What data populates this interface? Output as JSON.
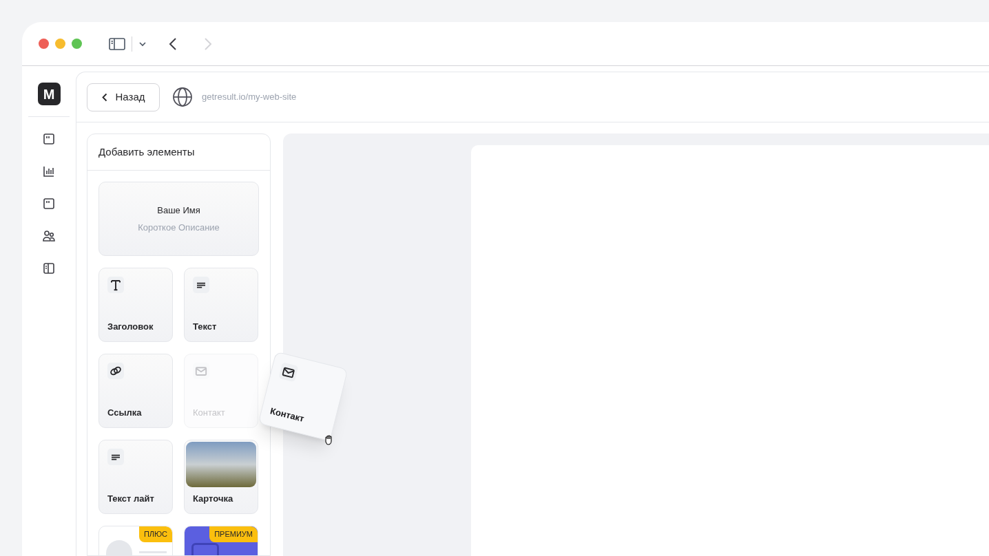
{
  "browser": {
    "back_enabled": true,
    "forward_enabled": false
  },
  "app": {
    "logo": "M"
  },
  "header": {
    "back_button": "Назад",
    "url": "getresult.io/my-web-site"
  },
  "panel": {
    "title": "Добавить элементы",
    "profile": {
      "name": "Ваше Имя",
      "description": "Короткое Описание"
    },
    "elements": [
      {
        "kind": "heading",
        "label": "Заголовок",
        "dragging": false
      },
      {
        "kind": "text",
        "label": "Текст",
        "dragging": false
      },
      {
        "kind": "link",
        "label": "Ссылка",
        "dragging": false
      },
      {
        "kind": "contact",
        "label": "Контакт",
        "dragging": true
      },
      {
        "kind": "text",
        "label": "Текст лайт",
        "dragging": false
      },
      {
        "kind": "photo",
        "label": "Карточка",
        "dragging": false
      },
      {
        "kind": "plus",
        "badge": "ПЛЮС"
      },
      {
        "kind": "premium",
        "badge": "ПРЕМИУМ"
      }
    ]
  },
  "drag_preview": {
    "kind": "contact",
    "label": "Контакт"
  }
}
